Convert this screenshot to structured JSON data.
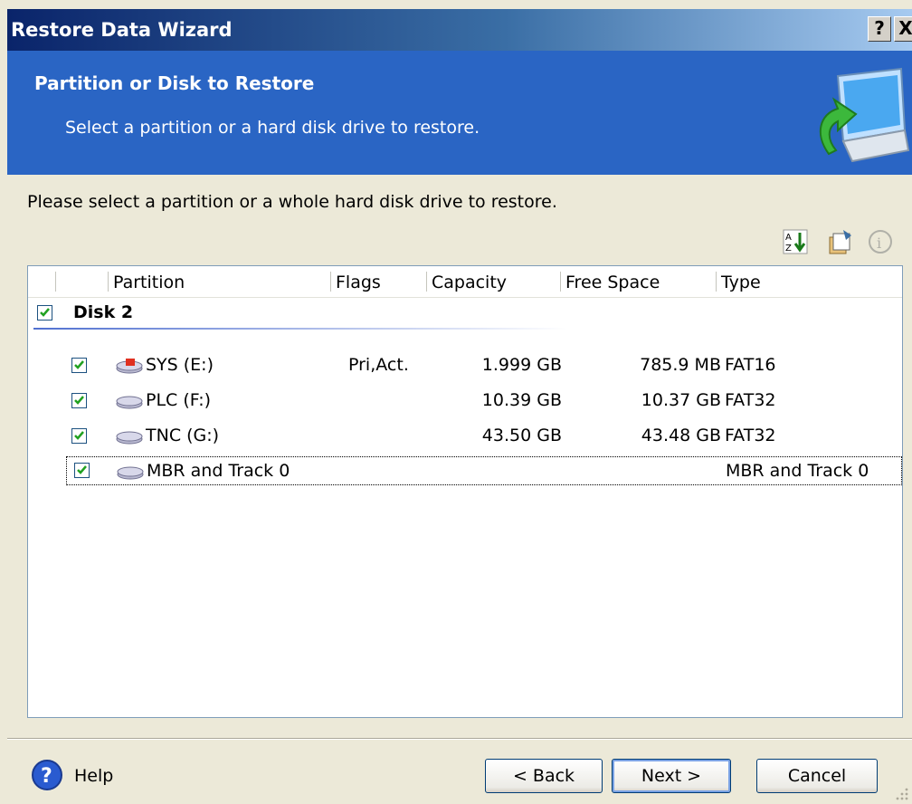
{
  "window": {
    "title": "Restore Data Wizard",
    "help_btn": "?",
    "close_btn": "X"
  },
  "header": {
    "title": "Partition or Disk to Restore",
    "subtitle": "Select a partition or a hard disk drive to restore."
  },
  "instruction": "Please select a partition or a whole hard disk drive to restore.",
  "list": {
    "columns": [
      "",
      "Partition",
      "Flags",
      "Capacity",
      "Free Space",
      "Type"
    ],
    "disk_label": "Disk 2",
    "rows": [
      {
        "name": "SYS (E:)",
        "flags": "Pri,Act.",
        "capacity": "1.999 GB",
        "free": "785.9 MB",
        "type": "FAT16"
      },
      {
        "name": "PLC (F:)",
        "flags": "",
        "capacity": "10.39 GB",
        "free": "10.37 GB",
        "type": "FAT32"
      },
      {
        "name": "TNC (G:)",
        "flags": "",
        "capacity": "43.50 GB",
        "free": "43.48 GB",
        "type": "FAT32"
      },
      {
        "name": "MBR and Track 0",
        "flags": "",
        "capacity": "",
        "free": "",
        "type": "MBR and Track 0"
      }
    ]
  },
  "footer": {
    "help": "Help",
    "back": "< Back",
    "next": "Next >",
    "cancel": "Cancel"
  },
  "colors": {
    "header_bg": "#2a65c4",
    "titlebar_start": "#0a246a",
    "check": "#21a121"
  }
}
